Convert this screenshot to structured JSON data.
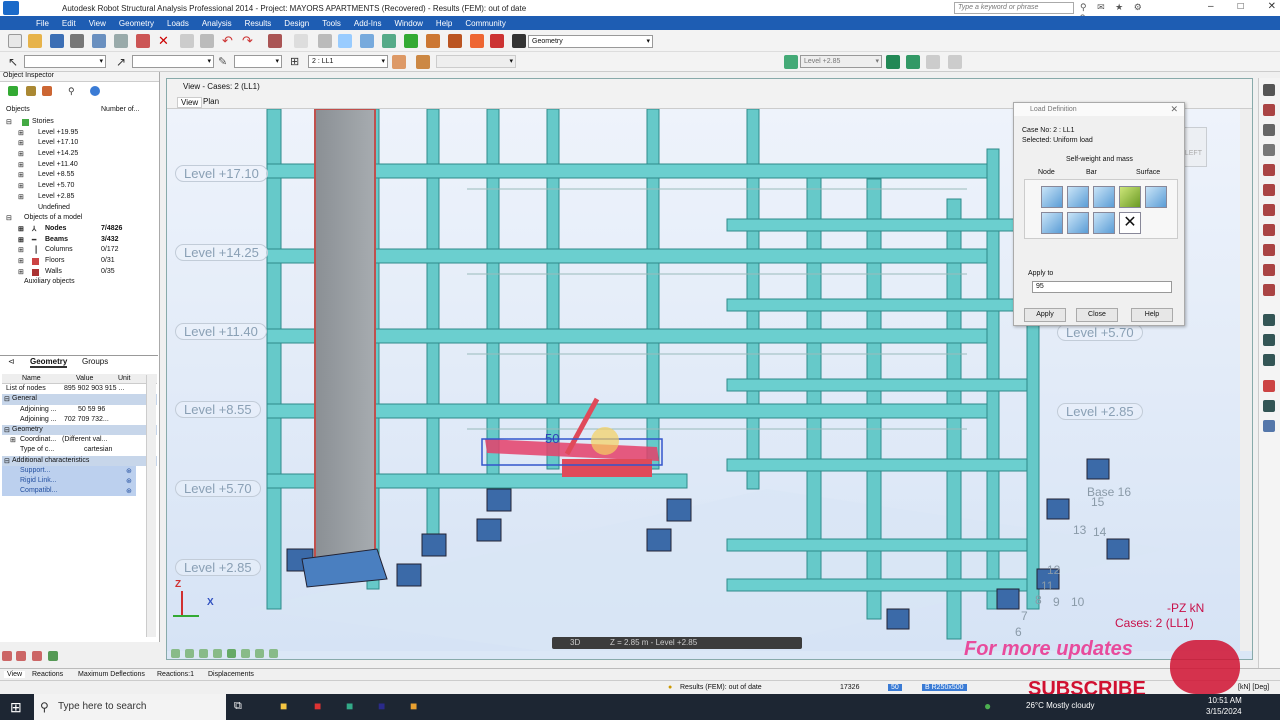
{
  "window": {
    "title": "Autodesk Robot Structural Analysis Professional 2014 - Project: MAYORS APARTMENTS (Recovered) - Results (FEM): out of date",
    "search_placeholder": "Type a keyword or phrase"
  },
  "menu": [
    "File",
    "Edit",
    "View",
    "Geometry",
    "Loads",
    "Analysis",
    "Results",
    "Design",
    "Tools",
    "Add-Ins",
    "Window",
    "Help",
    "Community"
  ],
  "toolbar": {
    "layout_combo": "Geometry",
    "case_combo": "2 : LL1",
    "level_combo": "Level +2.85"
  },
  "object_inspector": {
    "title": "Object Inspector",
    "col_objects": "Objects",
    "col_number": "Number of...",
    "stories_label": "Stories",
    "stories": [
      "Level +19.95",
      "Level +17.10",
      "Level +14.25",
      "Level +11.40",
      "Level +8.55",
      "Level +5.70",
      "Level +2.85",
      "Undefined"
    ],
    "model_label": "Objects of a model",
    "model_items": [
      {
        "name": "Nodes",
        "count": "7/4826"
      },
      {
        "name": "Beams",
        "count": "3/432"
      },
      {
        "name": "Columns",
        "count": "0/172"
      },
      {
        "name": "Floors",
        "count": "0/31"
      },
      {
        "name": "Walls",
        "count": "0/35"
      }
    ],
    "aux_label": "Auxiliary objects",
    "tab_geometry": "Geometry",
    "tab_groups": "Groups",
    "prop_headers": {
      "name": "Name",
      "value": "Value",
      "unit": "Unit"
    },
    "list_of_nodes": {
      "name": "List of nodes",
      "value": "895 902 903 915 ..."
    },
    "general_label": "General",
    "adjoining1": {
      "name": "Adjoining ...",
      "value": "50 59 96"
    },
    "adjoining2": {
      "name": "Adjoining ...",
      "value": "702 709 732..."
    },
    "geometry_label": "Geometry",
    "coordinates": {
      "name": "Coordinat...",
      "value": "(Different val..."
    },
    "type_of": {
      "name": "Type of c...",
      "value": "cartesian"
    },
    "additional_label": "Additional characteristics",
    "support": "Support...",
    "rigid": "Rigid Link...",
    "compat": "Compatibl..."
  },
  "view": {
    "title": "View - Cases: 2 (LL1)",
    "tab_view": "View",
    "tab_plan": "Plan",
    "levels_left": [
      "Level +17.10",
      "Level +14.25",
      "Level +11.40",
      "Level +8.55",
      "Level +5.70",
      "Level +2.85"
    ],
    "levels_right": [
      "Level +5.70",
      "Level +2.85"
    ],
    "bases": [
      "Base 16",
      "15",
      "13",
      "14",
      "12",
      "11",
      "8",
      "9",
      "10",
      "7",
      "6"
    ],
    "load_value": "50",
    "nav_3d": "3D",
    "nav_z": "Z = 2.85 m - Level +2.85",
    "cube_label": "LEFT",
    "result_units": "-PZ  kN",
    "result_cases": "Cases: 2 (LL1)",
    "axis_z": "Z",
    "axis_x": "X"
  },
  "load_dialog": {
    "title": "Load Definition",
    "case_no": "Case No: 2 : LL1",
    "selected": "Selected:     Uniform load",
    "self_weight": "Self-weight and mass",
    "tabs": [
      "Node",
      "Bar",
      "Surface"
    ],
    "apply_to_label": "Apply to",
    "apply_to_value": "95",
    "buttons": [
      "Apply",
      "Close",
      "Help"
    ]
  },
  "bottom_tabs": [
    "View",
    "Reactions",
    "Maximum Deflections",
    "Reactions:1",
    "Displacements"
  ],
  "status": {
    "results": "Results (FEM): out of date",
    "number": "17326",
    "node": "50",
    "section": "B R250x500",
    "units": "[kN] [Deg]"
  },
  "overlay": {
    "updates": "For more updates",
    "subscribe": "SUBSCRIBE"
  },
  "taskbar": {
    "search": "Type here to search",
    "weather": "26°C  Mostly cloudy",
    "time": "10:51 AM",
    "date": "3/15/2024"
  },
  "colors": {
    "menubar": "#1e5db3",
    "structure": "#5fc4c4",
    "load_highlight": "#e04060",
    "result_text": "#c8104a"
  }
}
